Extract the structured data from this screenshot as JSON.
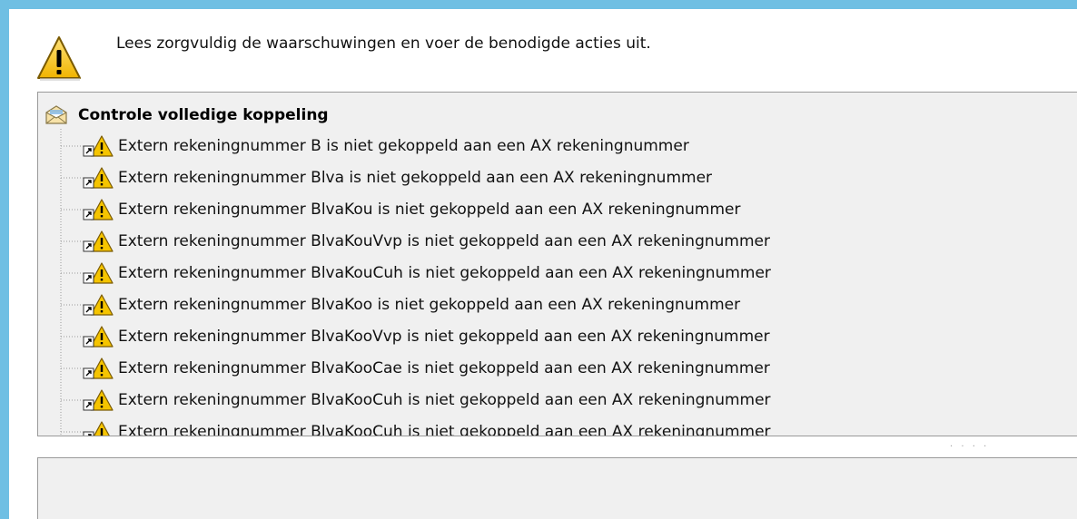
{
  "header": {
    "icon": "warning-icon",
    "message": "Lees zorgvuldig de waarschuwingen en voer de benodigde acties uit."
  },
  "tree": {
    "root": {
      "icon": "envelope-icon",
      "label": "Controle volledige koppeling"
    },
    "items": [
      {
        "icon": "warning-shortcut-icon",
        "label": "Extern rekeningnummer B is niet gekoppeld aan een AX rekeningnummer"
      },
      {
        "icon": "warning-shortcut-icon",
        "label": "Extern rekeningnummer Blva is niet gekoppeld aan een AX rekeningnummer"
      },
      {
        "icon": "warning-shortcut-icon",
        "label": "Extern rekeningnummer BlvaKou is niet gekoppeld aan een AX rekeningnummer"
      },
      {
        "icon": "warning-shortcut-icon",
        "label": "Extern rekeningnummer BlvaKouVvp is niet gekoppeld aan een AX rekeningnummer"
      },
      {
        "icon": "warning-shortcut-icon",
        "label": "Extern rekeningnummer BlvaKouCuh is niet gekoppeld aan een AX rekeningnummer"
      },
      {
        "icon": "warning-shortcut-icon",
        "label": "Extern rekeningnummer BlvaKoo is niet gekoppeld aan een AX rekeningnummer"
      },
      {
        "icon": "warning-shortcut-icon",
        "label": "Extern rekeningnummer BlvaKooVvp is niet gekoppeld aan een AX rekeningnummer"
      },
      {
        "icon": "warning-shortcut-icon",
        "label": "Extern rekeningnummer BlvaKooCae is niet gekoppeld aan een AX rekeningnummer"
      },
      {
        "icon": "warning-shortcut-icon",
        "label": "Extern rekeningnummer BlvaKooCuh is niet gekoppeld aan een AX rekeningnummer"
      },
      {
        "icon": "warning-shortcut-icon",
        "label": "Extern rekeningnummer BlvaKooCuh is niet gekoppeld aan een AX rekeningnummer"
      }
    ]
  },
  "splitter": {
    "grip": "· · · ·"
  },
  "colors": {
    "frame": "#6fbfe3",
    "panel_bg": "#f0f0f0",
    "panel_border": "#9a9a9a",
    "warning_yellow": "#f5c400"
  }
}
